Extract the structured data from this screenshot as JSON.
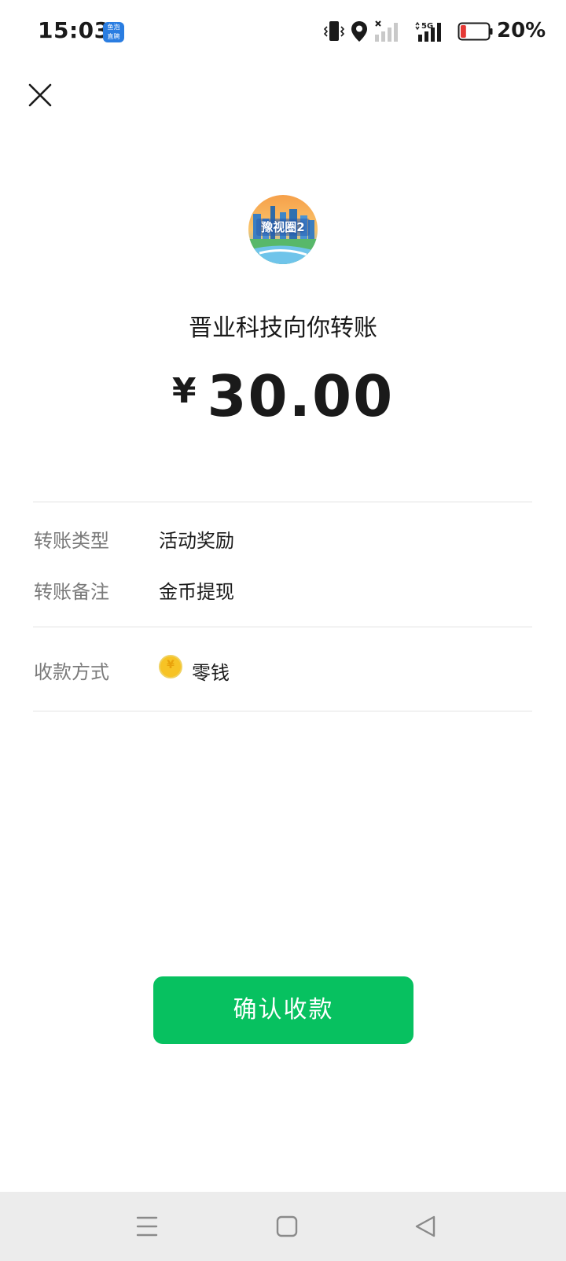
{
  "status_bar": {
    "time": "15:03",
    "app_badge_top": "鱼泡",
    "app_badge_bottom": "直聘",
    "network": "5G",
    "battery_percent": "20%",
    "battery_level": 0.2,
    "battery_color": "#e53935"
  },
  "header": {
    "close_icon": "close-icon"
  },
  "payer": {
    "avatar_text": "豫视圈2",
    "transfer_line": "晋业科技向你转账"
  },
  "amount": {
    "currency": "¥",
    "value": "30.00"
  },
  "details": [
    {
      "label": "转账类型",
      "value": "活动奖励"
    },
    {
      "label": "转账备注",
      "value": "金币提现"
    }
  ],
  "payment_method": {
    "label": "收款方式",
    "value": "零钱",
    "icon": "coin-icon"
  },
  "confirm_button": {
    "label": "确认收款",
    "color": "#07c160"
  },
  "nav_bar": {
    "menu_icon": "menu-icon",
    "home_icon": "home-icon",
    "back_icon": "back-icon"
  }
}
